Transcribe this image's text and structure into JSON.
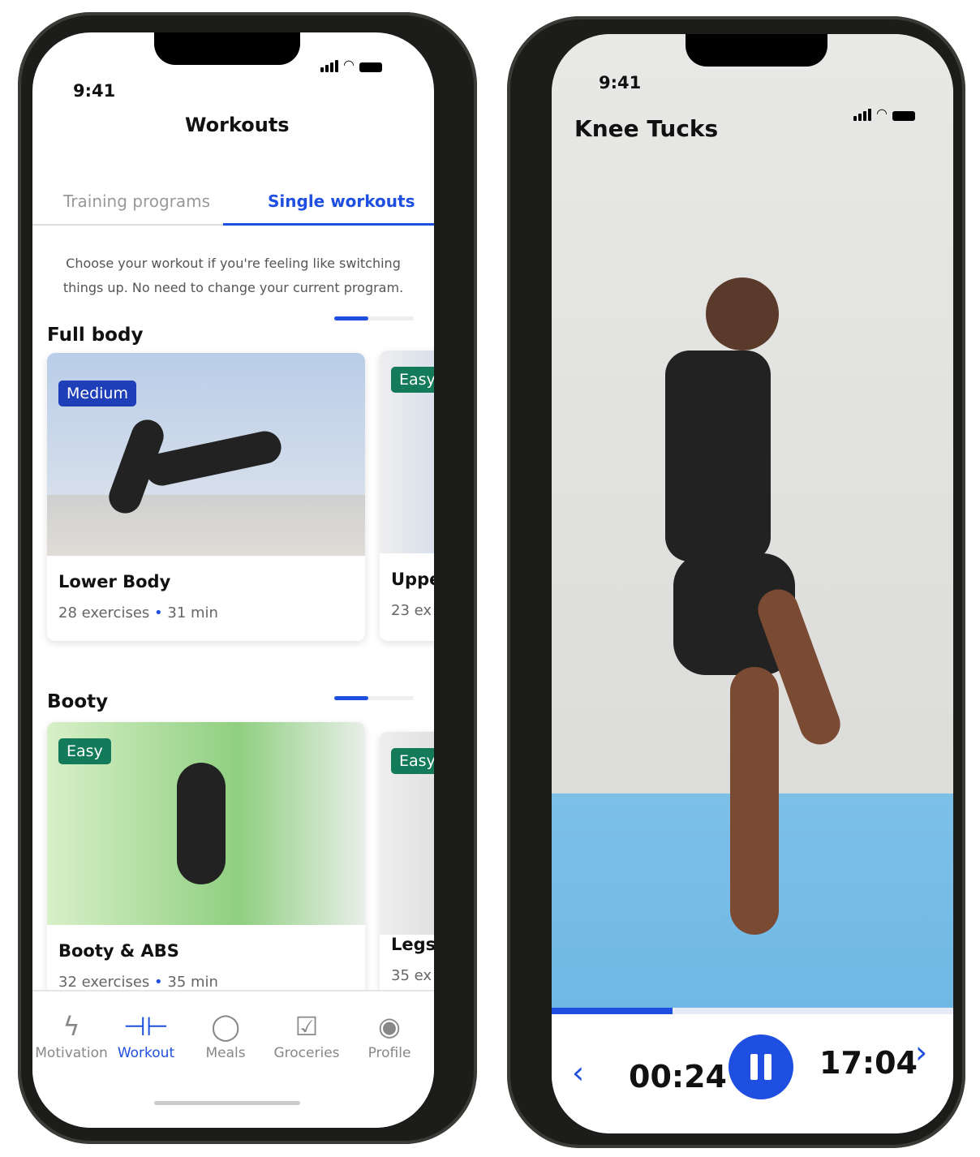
{
  "left_phone": {
    "status": {
      "time": "9:41"
    },
    "header": {
      "title": "Workouts"
    },
    "tabs": [
      {
        "label": "Training programs",
        "active": false
      },
      {
        "label": "Single workouts",
        "active": true
      }
    ],
    "description": "Choose your workout if you're feeling like switching things up. No need to change your current program.",
    "sections": [
      {
        "title": "Full body",
        "carousel_progress": 0.4,
        "cards": [
          {
            "badge": "Medium",
            "badge_color": "#1f3fb8",
            "name": "Lower Body",
            "exercises": "28 exercises",
            "duration": "31 min"
          },
          {
            "badge": "Easy",
            "badge_color": "#137a5a",
            "name": "Uppe",
            "exercises": "23 ex",
            "duration": ""
          }
        ]
      },
      {
        "title": "Booty",
        "carousel_progress": 0.4,
        "cards": [
          {
            "badge": "Easy",
            "badge_color": "#137a5a",
            "name": "Booty & ABS",
            "exercises": "32 exercises",
            "duration": "35 min"
          },
          {
            "badge": "Easy",
            "badge_color": "#137a5a",
            "name": "Legs",
            "exercises": "35 ex",
            "duration": ""
          }
        ]
      }
    ],
    "nav": [
      {
        "label": "Motivation",
        "icon": "lightning-icon",
        "active": false
      },
      {
        "label": "Workout",
        "icon": "dumbbell-icon",
        "active": true
      },
      {
        "label": "Meals",
        "icon": "apple-icon",
        "active": false
      },
      {
        "label": "Groceries",
        "icon": "checklist-icon",
        "active": false
      },
      {
        "label": "Profile",
        "icon": "user-circle-icon",
        "active": false
      }
    ],
    "accent": "#1f4fe0"
  },
  "right_phone": {
    "status": {
      "time": "9:41"
    },
    "exercise_title": "Knee Tucks",
    "video_progress": 0.3,
    "elapsed": "00:24",
    "remaining": "17:04"
  }
}
